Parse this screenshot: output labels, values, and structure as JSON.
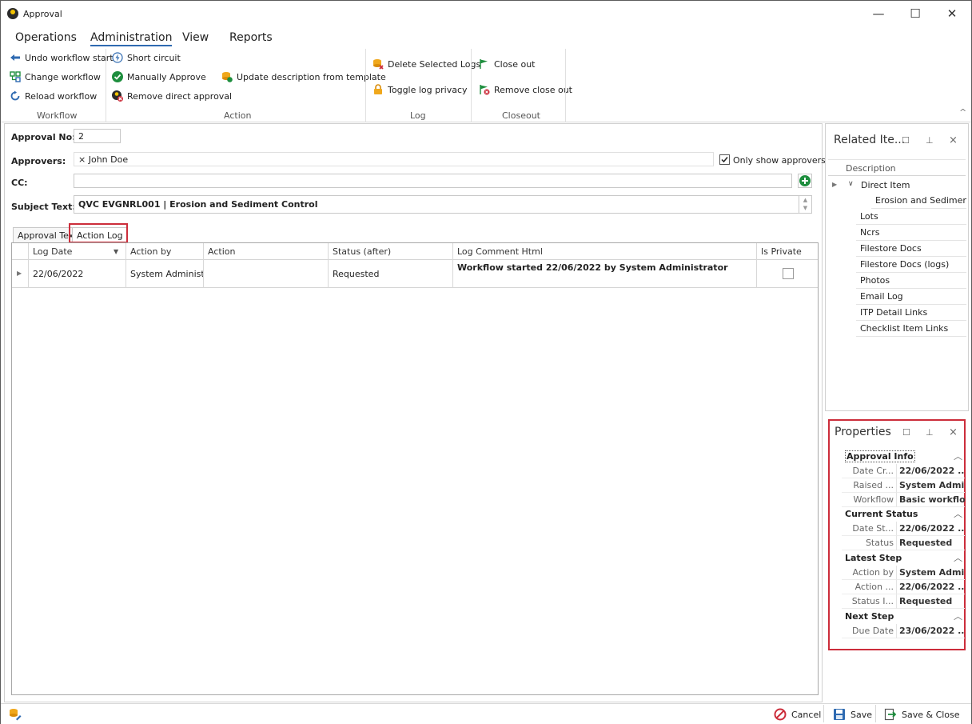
{
  "window": {
    "title": "Approval",
    "minimize": "—",
    "maximize": "☐",
    "close": "✕"
  },
  "menu": [
    "Operations",
    "Administration",
    "View",
    "Reports"
  ],
  "ribbon": {
    "workflow": {
      "label": "Workflow",
      "items": [
        "Undo workflow start",
        "Change workflow",
        "Reload workflow"
      ]
    },
    "action": {
      "label": "Action",
      "items": [
        "Short circuit",
        "Manually Approve",
        "Remove direct approval",
        "Update description from template"
      ]
    },
    "log": {
      "label": "Log",
      "items": [
        "Delete Selected Logs",
        "Toggle log privacy"
      ]
    },
    "closeout": {
      "label": "Closeout",
      "items": [
        "Close out",
        "Remove close out"
      ]
    },
    "collapse_glyph": "^"
  },
  "form": {
    "approval_no_label": "Approval No:",
    "approval_no": "2",
    "approvers_label": "Approvers:",
    "approver_chip": "× John  Doe",
    "only_show_approvers": "Only show approvers",
    "cc_label": "CC:",
    "cc_value": "",
    "subject_label": "Subject Text:",
    "subject_value": "QVC EVGNRL001 | Erosion and Sediment Control"
  },
  "tabs": [
    "Approval Text",
    "Action Log"
  ],
  "grid": {
    "columns": [
      "Log Date",
      "Action by",
      "Action",
      "Status (after)",
      "Log Comment Html",
      "Is Private"
    ],
    "rows": [
      {
        "log_date": "22/06/2022",
        "action_by": "System Administr...",
        "action": "",
        "status_after": "Requested",
        "comment": "Workflow started 22/06/2022 by System Administrator",
        "is_private": false
      }
    ]
  },
  "related_items": {
    "title": "Related Ite...",
    "header": "Description",
    "root": "Direct Item",
    "child": "Erosion and Sediment ...",
    "items": [
      "Lots",
      "Ncrs",
      "Filestore Docs",
      "Filestore Docs (logs)",
      "Photos",
      "Email Log",
      "ITP Detail Links",
      "Checklist Item Links"
    ]
  },
  "properties": {
    "title": "Properties",
    "categories": [
      {
        "name": "Approval Info",
        "rows": [
          [
            "Date Cr...",
            "22/06/2022 ..."
          ],
          [
            "Raised ...",
            "System Admi..."
          ],
          [
            "Workflow",
            "Basic workflow"
          ]
        ]
      },
      {
        "name": "Current Status",
        "rows": [
          [
            "Date St...",
            "22/06/2022 ..."
          ],
          [
            "Status",
            "Requested"
          ]
        ]
      },
      {
        "name": "Latest Step",
        "rows": [
          [
            "Action by",
            "System Admi..."
          ],
          [
            "Action ...",
            "22/06/2022 ..."
          ],
          [
            "Status I...",
            "Requested"
          ]
        ]
      },
      {
        "name": "Next Step",
        "rows": [
          [
            "Due Date",
            "23/06/2022 ..."
          ]
        ]
      }
    ]
  },
  "statusbar": {
    "cancel": "Cancel",
    "save": "Save",
    "save_close": "Save & Close"
  },
  "colors": {
    "accent": "#2e6ab1",
    "highlight": "#cc2d3b",
    "green": "#1e8e3e",
    "orange": "#f0a81c"
  }
}
